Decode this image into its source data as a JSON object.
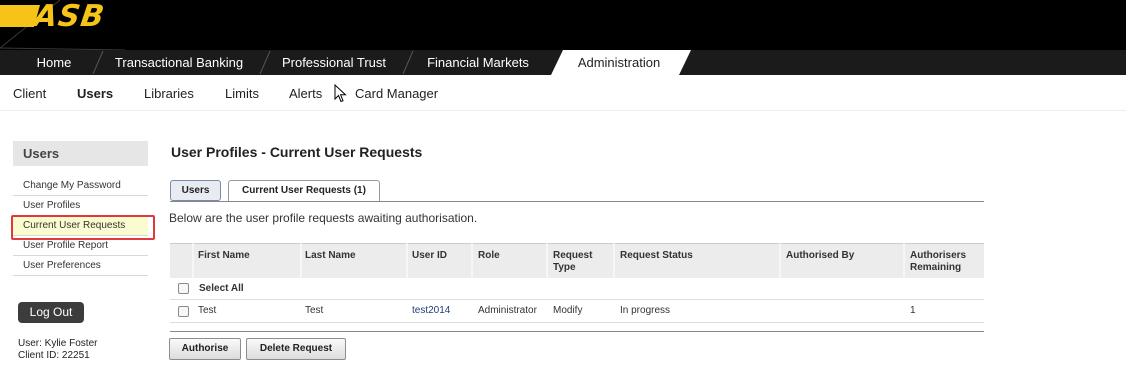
{
  "brand": {
    "logo_text": "ASB",
    "accent": "#f6c319"
  },
  "nav": {
    "items": [
      {
        "label": "Home"
      },
      {
        "label": "Transactional Banking"
      },
      {
        "label": "Professional Trust"
      },
      {
        "label": "Financial Markets"
      },
      {
        "label": "Administration"
      }
    ],
    "active_index": 4
  },
  "subnav": {
    "items": [
      {
        "label": "Client"
      },
      {
        "label": "Users"
      },
      {
        "label": "Libraries"
      },
      {
        "label": "Limits"
      },
      {
        "label": "Alerts"
      },
      {
        "label": "Card Manager"
      }
    ],
    "active_index": 1
  },
  "sidebar": {
    "heading": "Users",
    "links": [
      {
        "label": "Change My Password"
      },
      {
        "label": "User Profiles"
      },
      {
        "label": "Current User Requests"
      },
      {
        "label": "User Profile Report"
      },
      {
        "label": "User Preferences"
      }
    ],
    "highlighted_index": 2,
    "logout_label": "Log Out",
    "user_line": "User: Kylie Foster",
    "client_line": "Client ID: 22251"
  },
  "main": {
    "title": "User Profiles - Current User Requests",
    "tabs": [
      {
        "label": "Users"
      },
      {
        "label": "Current User Requests (1)"
      }
    ],
    "intro": "Below are the user profile requests awaiting authorisation.",
    "columns": [
      "First Name",
      "Last Name",
      "User ID",
      "Role",
      "Request Type",
      "Request Status",
      "Authorised By",
      "Authorisers Remaining"
    ],
    "columns_display": {
      "request_type_1": "Request",
      "request_type_2": "Type",
      "auth_remaining_1": "Authorisers",
      "auth_remaining_2": "Remaining"
    },
    "select_all_label": "Select All",
    "rows": [
      {
        "first_name": "Test",
        "last_name": "Test",
        "user_id": "test2014",
        "role": "Administrator",
        "request_type": "Modify",
        "request_status": "In progress",
        "authorised_by": "",
        "authorisers_remaining": "1"
      }
    ],
    "buttons": {
      "authorise": "Authorise",
      "delete": "Delete Request"
    }
  }
}
